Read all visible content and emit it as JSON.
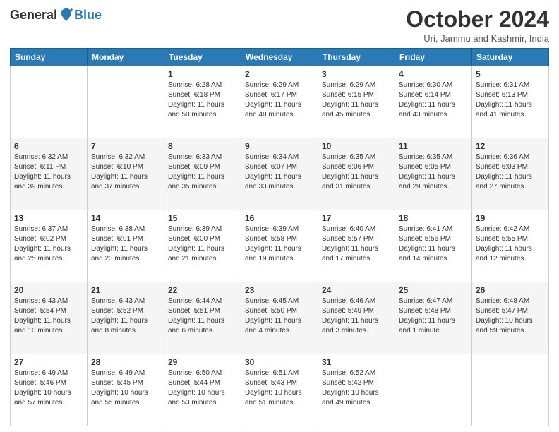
{
  "header": {
    "logo_general": "General",
    "logo_blue": "Blue",
    "month_title": "October 2024",
    "location": "Uri, Jammu and Kashmir, India"
  },
  "days_of_week": [
    "Sunday",
    "Monday",
    "Tuesday",
    "Wednesday",
    "Thursday",
    "Friday",
    "Saturday"
  ],
  "weeks": [
    [
      {
        "day": null,
        "sunrise": null,
        "sunset": null,
        "daylight": null
      },
      {
        "day": null,
        "sunrise": null,
        "sunset": null,
        "daylight": null
      },
      {
        "day": "1",
        "sunrise": "Sunrise: 6:28 AM",
        "sunset": "Sunset: 6:18 PM",
        "daylight": "Daylight: 11 hours and 50 minutes."
      },
      {
        "day": "2",
        "sunrise": "Sunrise: 6:29 AM",
        "sunset": "Sunset: 6:17 PM",
        "daylight": "Daylight: 11 hours and 48 minutes."
      },
      {
        "day": "3",
        "sunrise": "Sunrise: 6:29 AM",
        "sunset": "Sunset: 6:15 PM",
        "daylight": "Daylight: 11 hours and 45 minutes."
      },
      {
        "day": "4",
        "sunrise": "Sunrise: 6:30 AM",
        "sunset": "Sunset: 6:14 PM",
        "daylight": "Daylight: 11 hours and 43 minutes."
      },
      {
        "day": "5",
        "sunrise": "Sunrise: 6:31 AM",
        "sunset": "Sunset: 6:13 PM",
        "daylight": "Daylight: 11 hours and 41 minutes."
      }
    ],
    [
      {
        "day": "6",
        "sunrise": "Sunrise: 6:32 AM",
        "sunset": "Sunset: 6:11 PM",
        "daylight": "Daylight: 11 hours and 39 minutes."
      },
      {
        "day": "7",
        "sunrise": "Sunrise: 6:32 AM",
        "sunset": "Sunset: 6:10 PM",
        "daylight": "Daylight: 11 hours and 37 minutes."
      },
      {
        "day": "8",
        "sunrise": "Sunrise: 6:33 AM",
        "sunset": "Sunset: 6:09 PM",
        "daylight": "Daylight: 11 hours and 35 minutes."
      },
      {
        "day": "9",
        "sunrise": "Sunrise: 6:34 AM",
        "sunset": "Sunset: 6:07 PM",
        "daylight": "Daylight: 11 hours and 33 minutes."
      },
      {
        "day": "10",
        "sunrise": "Sunrise: 6:35 AM",
        "sunset": "Sunset: 6:06 PM",
        "daylight": "Daylight: 11 hours and 31 minutes."
      },
      {
        "day": "11",
        "sunrise": "Sunrise: 6:35 AM",
        "sunset": "Sunset: 6:05 PM",
        "daylight": "Daylight: 11 hours and 29 minutes."
      },
      {
        "day": "12",
        "sunrise": "Sunrise: 6:36 AM",
        "sunset": "Sunset: 6:03 PM",
        "daylight": "Daylight: 11 hours and 27 minutes."
      }
    ],
    [
      {
        "day": "13",
        "sunrise": "Sunrise: 6:37 AM",
        "sunset": "Sunset: 6:02 PM",
        "daylight": "Daylight: 11 hours and 25 minutes."
      },
      {
        "day": "14",
        "sunrise": "Sunrise: 6:38 AM",
        "sunset": "Sunset: 6:01 PM",
        "daylight": "Daylight: 11 hours and 23 minutes."
      },
      {
        "day": "15",
        "sunrise": "Sunrise: 6:39 AM",
        "sunset": "Sunset: 6:00 PM",
        "daylight": "Daylight: 11 hours and 21 minutes."
      },
      {
        "day": "16",
        "sunrise": "Sunrise: 6:39 AM",
        "sunset": "Sunset: 5:58 PM",
        "daylight": "Daylight: 11 hours and 19 minutes."
      },
      {
        "day": "17",
        "sunrise": "Sunrise: 6:40 AM",
        "sunset": "Sunset: 5:57 PM",
        "daylight": "Daylight: 11 hours and 17 minutes."
      },
      {
        "day": "18",
        "sunrise": "Sunrise: 6:41 AM",
        "sunset": "Sunset: 5:56 PM",
        "daylight": "Daylight: 11 hours and 14 minutes."
      },
      {
        "day": "19",
        "sunrise": "Sunrise: 6:42 AM",
        "sunset": "Sunset: 5:55 PM",
        "daylight": "Daylight: 11 hours and 12 minutes."
      }
    ],
    [
      {
        "day": "20",
        "sunrise": "Sunrise: 6:43 AM",
        "sunset": "Sunset: 5:54 PM",
        "daylight": "Daylight: 11 hours and 10 minutes."
      },
      {
        "day": "21",
        "sunrise": "Sunrise: 6:43 AM",
        "sunset": "Sunset: 5:52 PM",
        "daylight": "Daylight: 11 hours and 8 minutes."
      },
      {
        "day": "22",
        "sunrise": "Sunrise: 6:44 AM",
        "sunset": "Sunset: 5:51 PM",
        "daylight": "Daylight: 11 hours and 6 minutes."
      },
      {
        "day": "23",
        "sunrise": "Sunrise: 6:45 AM",
        "sunset": "Sunset: 5:50 PM",
        "daylight": "Daylight: 11 hours and 4 minutes."
      },
      {
        "day": "24",
        "sunrise": "Sunrise: 6:46 AM",
        "sunset": "Sunset: 5:49 PM",
        "daylight": "Daylight: 11 hours and 3 minutes."
      },
      {
        "day": "25",
        "sunrise": "Sunrise: 6:47 AM",
        "sunset": "Sunset: 5:48 PM",
        "daylight": "Daylight: 11 hours and 1 minute."
      },
      {
        "day": "26",
        "sunrise": "Sunrise: 6:48 AM",
        "sunset": "Sunset: 5:47 PM",
        "daylight": "Daylight: 10 hours and 59 minutes."
      }
    ],
    [
      {
        "day": "27",
        "sunrise": "Sunrise: 6:49 AM",
        "sunset": "Sunset: 5:46 PM",
        "daylight": "Daylight: 10 hours and 57 minutes."
      },
      {
        "day": "28",
        "sunrise": "Sunrise: 6:49 AM",
        "sunset": "Sunset: 5:45 PM",
        "daylight": "Daylight: 10 hours and 55 minutes."
      },
      {
        "day": "29",
        "sunrise": "Sunrise: 6:50 AM",
        "sunset": "Sunset: 5:44 PM",
        "daylight": "Daylight: 10 hours and 53 minutes."
      },
      {
        "day": "30",
        "sunrise": "Sunrise: 6:51 AM",
        "sunset": "Sunset: 5:43 PM",
        "daylight": "Daylight: 10 hours and 51 minutes."
      },
      {
        "day": "31",
        "sunrise": "Sunrise: 6:52 AM",
        "sunset": "Sunset: 5:42 PM",
        "daylight": "Daylight: 10 hours and 49 minutes."
      },
      {
        "day": null,
        "sunrise": null,
        "sunset": null,
        "daylight": null
      },
      {
        "day": null,
        "sunrise": null,
        "sunset": null,
        "daylight": null
      }
    ]
  ]
}
